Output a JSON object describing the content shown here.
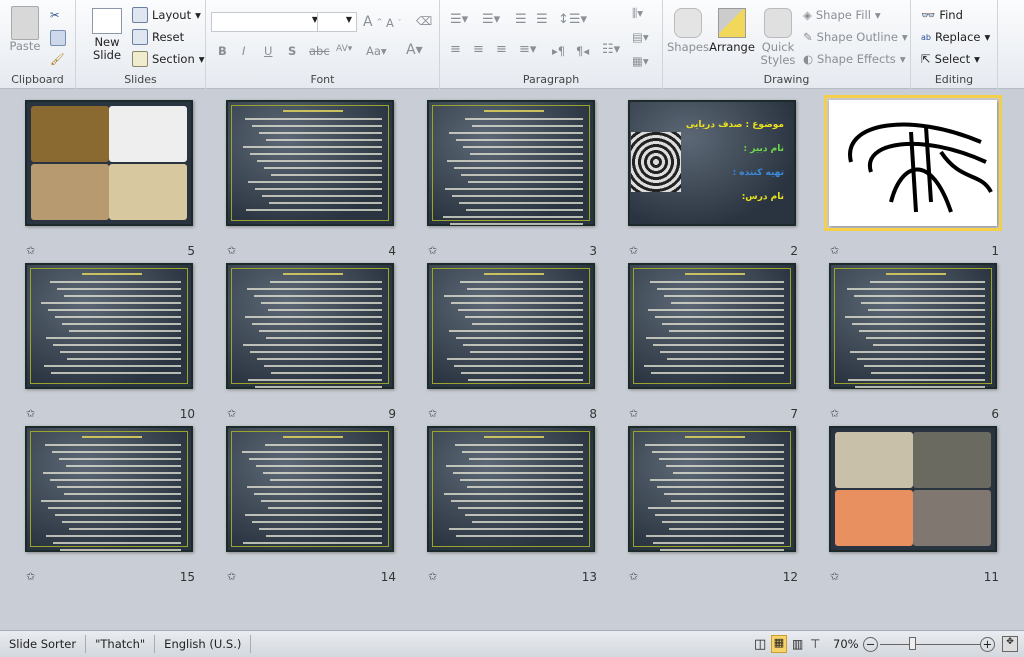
{
  "ribbon": {
    "clipboard": {
      "label": "Clipboard",
      "paste": "Paste"
    },
    "slides": {
      "label": "Slides",
      "new_slide": "New Slide",
      "layout": "Layout",
      "reset": "Reset",
      "section": "Section"
    },
    "font": {
      "label": "Font",
      "font_name": "",
      "font_size": ""
    },
    "paragraph": {
      "label": "Paragraph"
    },
    "drawing": {
      "label": "Drawing",
      "shapes": "Shapes",
      "arrange": "Arrange",
      "quick_styles": "Quick Styles",
      "shape_fill": "Shape Fill",
      "shape_outline": "Shape Outline",
      "shape_effects": "Shape Effects"
    },
    "editing": {
      "label": "Editing",
      "find": "Find",
      "replace": "Replace",
      "select": "Select"
    }
  },
  "slides": [
    {
      "number": "1",
      "kind": "calligraphy",
      "selected": true
    },
    {
      "number": "2",
      "kind": "title",
      "lines": [
        "موضوع : صدف دریایی",
        "نام دبیر :",
        "تهیه کننده :",
        "نام درس:"
      ],
      "colors": [
        "#e8e020",
        "#6fd84a",
        "#3a8ad8",
        "#e8e020"
      ]
    },
    {
      "number": "3",
      "kind": "text"
    },
    {
      "number": "4",
      "kind": "text"
    },
    {
      "number": "5",
      "kind": "photos"
    },
    {
      "number": "6",
      "kind": "text"
    },
    {
      "number": "7",
      "kind": "text"
    },
    {
      "number": "8",
      "kind": "text"
    },
    {
      "number": "9",
      "kind": "text"
    },
    {
      "number": "10",
      "kind": "text"
    },
    {
      "number": "11",
      "kind": "photos2"
    },
    {
      "number": "12",
      "kind": "text"
    },
    {
      "number": "13",
      "kind": "text"
    },
    {
      "number": "14",
      "kind": "text"
    },
    {
      "number": "15",
      "kind": "text"
    }
  ],
  "status": {
    "view": "Slide Sorter",
    "theme": "\"Thatch\"",
    "language": "English (U.S.)",
    "zoom": "70%",
    "zoom_percent": 70
  },
  "colors": {
    "selection": "#f3cf4a",
    "slide_border": "#9aa32a"
  }
}
